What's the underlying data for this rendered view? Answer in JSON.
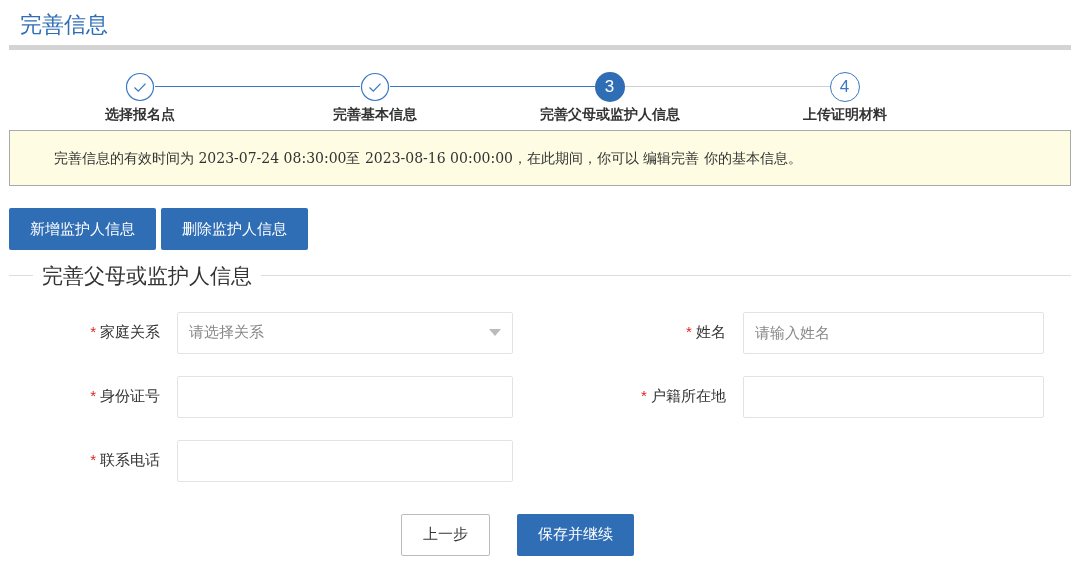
{
  "page_title": "完善信息",
  "steps": [
    {
      "label": "选择报名点",
      "kind": "done"
    },
    {
      "label": "完善基本信息",
      "kind": "done"
    },
    {
      "label": "完善父母或监护人信息",
      "kind": "current",
      "number": "3"
    },
    {
      "label": "上传证明材料",
      "kind": "todo",
      "number": "4"
    }
  ],
  "notice": "完善信息的有效时间为 2023-07-24 08:30:00至 2023-08-16 00:00:00，在此期间，你可以 编辑完善 你的基本信息。",
  "action_buttons": [
    "新增监护人信息",
    "删除监护人信息"
  ],
  "section_title": "完善父母或监护人信息",
  "fields": [
    {
      "required_mark": "*",
      "label": "家庭关系",
      "kind": "select",
      "placeholder": "请选择关系"
    },
    {
      "required_mark": "*",
      "label": "姓名",
      "kind": "text",
      "placeholder": "请输入姓名"
    },
    {
      "required_mark": "*",
      "label": "身份证号",
      "kind": "text"
    },
    {
      "required_mark": "*",
      "label": "户籍所在地",
      "kind": "text"
    },
    {
      "required_mark": "*",
      "label": "联系电话",
      "kind": "text"
    }
  ],
  "footer_buttons": [
    {
      "label": "上一步",
      "kind": "secondary"
    },
    {
      "label": "保存并继续",
      "kind": "primary"
    }
  ]
}
